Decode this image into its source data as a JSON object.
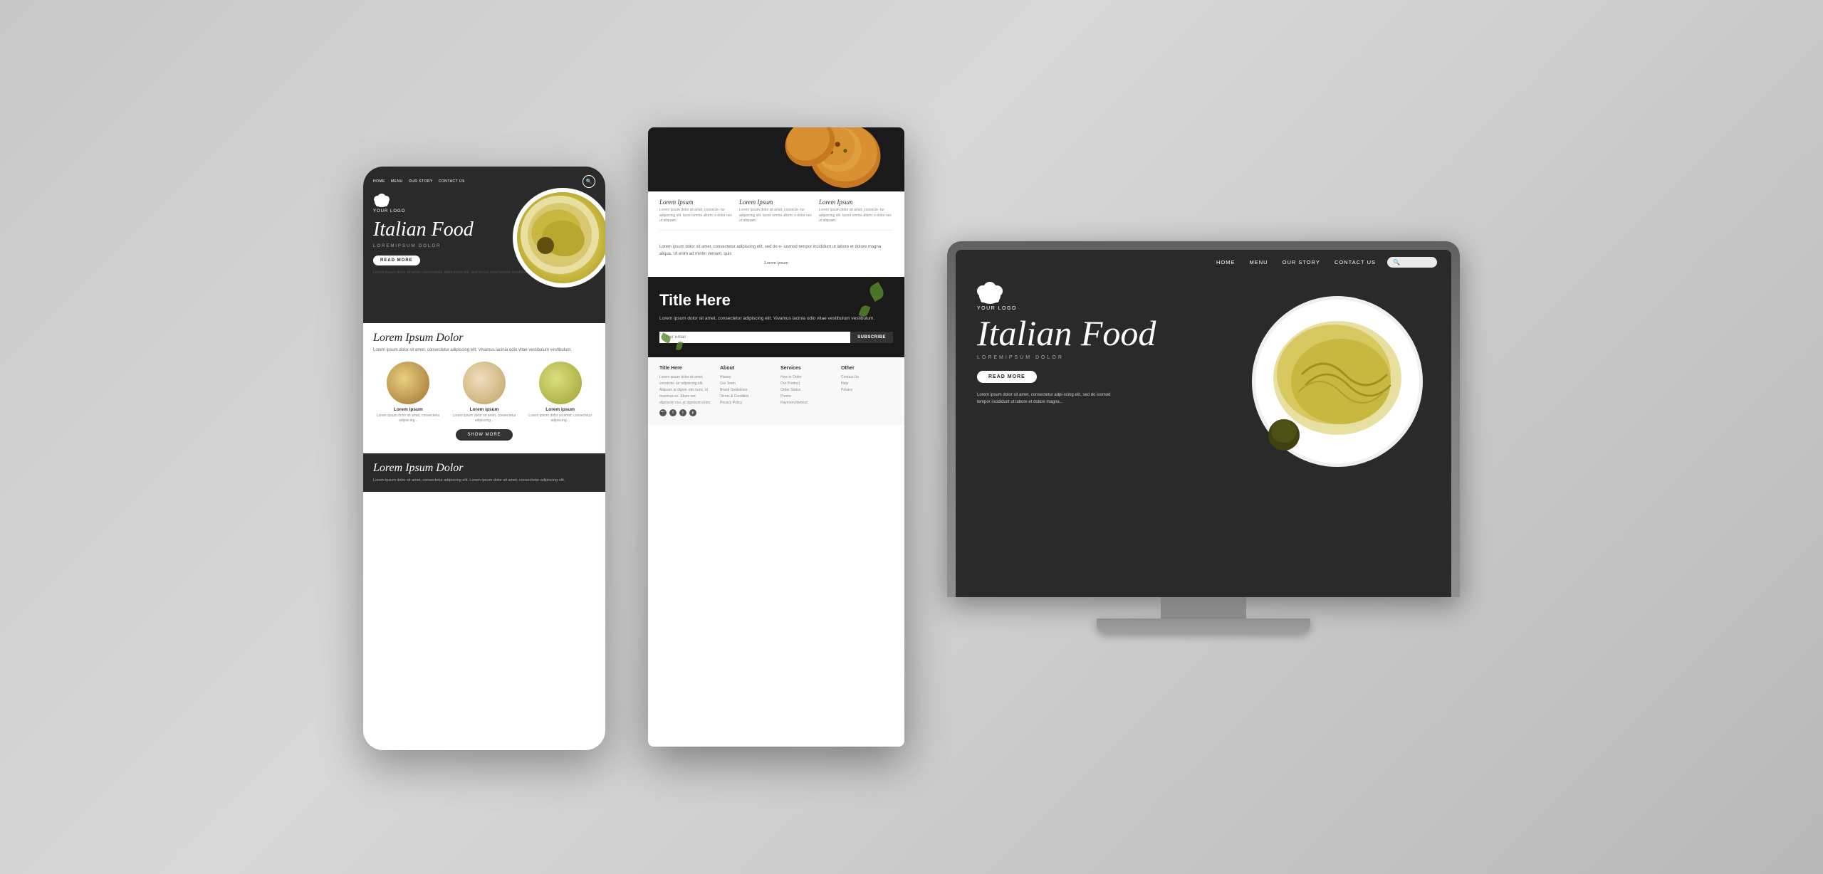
{
  "background": {
    "color": "#cccccc"
  },
  "mobile": {
    "nav": {
      "links": [
        "HOME",
        "MENU",
        "OUR STORY",
        "CONTACT US"
      ]
    },
    "logo": "YOUR LOGO",
    "hero_title": "Italian Food",
    "hero_subtitle": "LOREMIPSUM DOLOR",
    "read_more": "READ MORE",
    "body_text": "Lorem ipsum dolor sit amet, consectetur adipi-scing elit, sed do ius mod tempor incididunt ut labore et dolore magna...",
    "section_title": "Lorem Ipsum Dolor",
    "section_text": "Lorem ipsum dolor sit amet, consectetur adipiscing elit. Vivamus lacinia odio vitae vestibulum vestibulum.",
    "food_items": [
      {
        "title": "Lorem ipsum",
        "desc": "Lorem ipsum dolor sit amet, consectetur  adipiscing..."
      },
      {
        "title": "Lorem ipsum",
        "desc": "Lorem ipsum dolor sit amet, consectetur  adipiscing..."
      },
      {
        "title": "Lorem ipsum",
        "desc": "Lorem ipsum dolor sit amet, consectetur  adipiscing..."
      }
    ],
    "show_more": "SHOW MORE",
    "footer_title": "Lorem Ipsum Dolor",
    "footer_text": "Lorem ipsum dolor sit amet, consectetur adipiscing elit. Lorem ipsum dolor sit amet, consectetur adipiscing elit."
  },
  "tablet": {
    "cards": [
      {
        "title": "Lorem Ipsum",
        "text": "Lorem ipsum dolor sit amet, consecte- tur adipiscing elit, tacen omnia ullumc e dolor nec ut aliquam."
      },
      {
        "title": "Lorem Ipsum",
        "text": "Lorem ipsum dolor sit amet, consecte- tur adipiscing elit, tacen omnia ullumc e dolor nec ut aliquam."
      },
      {
        "title": "Lorem Ipsum",
        "text": "Lorem ipsum dolor sit amet, consecte- tur adipiscing elit, tacen omnia ullumc e dolor nec ut aliquam."
      }
    ],
    "paragraph": "Lorem ipsum dolor sit amet, consectetur adipiscing elit, sed do e- iusmod tempor incididunt ut labore et dolore magna aliqua. Ut enim ad minim veniam, quis",
    "lorem_link": "Lorem ipsum",
    "cta_title": "Title Here",
    "cta_text": "Lorem ipsum dolor sit amet, consectetur adipiscing elit. Vivamus lacinia odio vitae vestibulum vestibulum.",
    "email_placeholder": "Your Email",
    "subscribe_label": "SUBSCRIBE",
    "footer": {
      "col1_title": "Title Here",
      "col1_text": "Lorem ipsum dolor sit amet, consecte- tur adipiscing elit. Aliquam at dignis- sim nunc, id maximus ex. Etiam nec dignissim nisi, at dignissim enim.",
      "col2_title": "About",
      "col2_items": [
        "History",
        "Our Team",
        "Brand Guidelines",
        "Terms & Condition",
        "Privacy Policy"
      ],
      "col3_title": "Services",
      "col3_items": [
        "How to Order",
        "Our Product",
        "Order Status",
        "Promo",
        "Payment Method"
      ],
      "col4_title": "Other",
      "col4_items": [
        "Contact Us",
        "Help",
        "Privacy"
      ]
    }
  },
  "monitor": {
    "nav": {
      "links": [
        "HOME",
        "MENU",
        "OUR STORY",
        "CONTACT US"
      ]
    },
    "logo": "YOUR LOGO",
    "hero_title": "Italian Food",
    "hero_subtitle": "LOREMIPSUM DOLOR",
    "read_more": "READ MORE",
    "body_text": "Lorem ipsum dolor sit amet, consectetur adpi-scing elit, sed do iusmod tempor incididunt ut labore et dolore magna..."
  }
}
